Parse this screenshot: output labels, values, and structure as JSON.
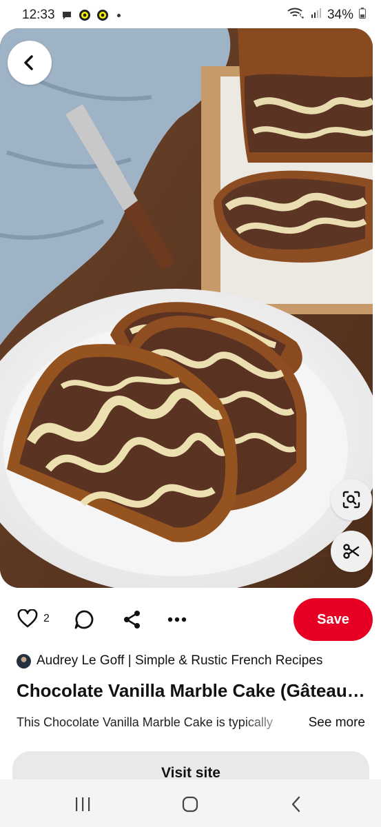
{
  "status_bar": {
    "time": "12:33",
    "battery": "34%",
    "icons": [
      "chat-notification-icon",
      "snapchat-icon",
      "snapchat-icon",
      "wifi-call-icon",
      "signal-icon",
      "battery-icon"
    ]
  },
  "pin": {
    "image_description_icon": "marble-cake-photo",
    "like_count": "2",
    "save_label": "Save",
    "creator": "Audrey Le Goff | Simple & Rustic French Recipes",
    "title": "Chocolate Vanilla Marble Cake (Gâteau Marbré)",
    "description": "This Chocolate Vanilla Marble Cake is typically",
    "see_more_label": "See more",
    "visit_label": "Visit site"
  },
  "colors": {
    "save": "#e60023",
    "visit_bg": "#e9e9e9",
    "nav_bg": "#f4f4f4"
  }
}
